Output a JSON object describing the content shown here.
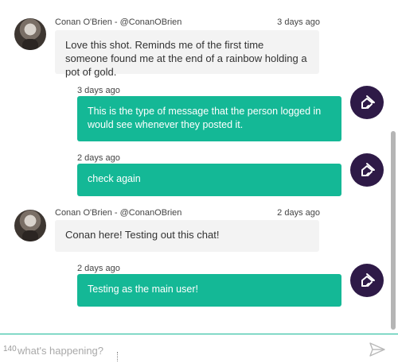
{
  "messages": [
    {
      "direction": "incoming",
      "author": "Conan O'Brien - @ConanOBrien",
      "time": "3 days ago",
      "text": "Love this shot. Reminds me of the first time someone found me at the end of a rainbow holding a pot of gold."
    },
    {
      "direction": "outgoing",
      "time": "3 days ago",
      "text": "This is the type of message that the person logged in would see whenever they posted it."
    },
    {
      "direction": "outgoing",
      "time": "2 days ago",
      "text": "check again"
    },
    {
      "direction": "incoming",
      "author": "Conan O'Brien - @ConanOBrien",
      "time": "2 days ago",
      "text": "Conan here! Testing out this chat!"
    },
    {
      "direction": "outgoing",
      "time": "2 days ago",
      "text": "Testing as the main user!"
    }
  ],
  "composer": {
    "char_count": "140",
    "placeholder": "what's happening?"
  },
  "icons": {
    "outgoing_avatar": "house-logo-icon",
    "send": "send-icon"
  },
  "colors": {
    "outgoing_bubble": "#14b896",
    "incoming_bubble": "#f3f3f3",
    "avatar_bg": "#2e1a47",
    "composer_border": "#17b897"
  }
}
